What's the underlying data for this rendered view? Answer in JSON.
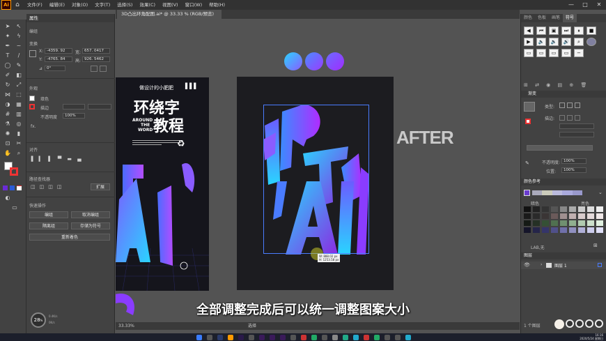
{
  "app": {
    "logo": "Ai",
    "menus": [
      "文件(F)",
      "编辑(E)",
      "对象(O)",
      "文字(T)",
      "选择(S)",
      "效果(C)",
      "视图(V)",
      "窗口(W)",
      "帮助(H)"
    ],
    "window_controls": [
      "—",
      "□",
      "✕"
    ]
  },
  "document": {
    "tab_title": "3D凸出环角配图.ai* @ 33.33 % (RGB/预览)",
    "close": "×"
  },
  "properties": {
    "tab": "属性",
    "group_label": "编组",
    "transform_label": "变换",
    "x_label": "X:",
    "x_value": "-4359. 92",
    "y_label": "Y:",
    "y_value": "-4765. 84",
    "w_label": "宽:",
    "w_value": "657. 0417",
    "h_label": "高:",
    "h_value": "926. 5462",
    "angle_value": "0°",
    "appearance_label": "外观",
    "fill_label": "填色",
    "stroke_label": "描边",
    "opacity_label": "不透明度",
    "opacity_value": "100%",
    "fx_label": "fx.",
    "align_label": "对齐",
    "pathfinder_label": "路径查找器",
    "expand_label": "扩展",
    "quick_actions_label": "快速操作",
    "btn_edit": "编组",
    "btn_ungroup": "取消编组",
    "btn_isolate": "隔离组",
    "btn_save_symbol": "存储为符号",
    "btn_recolor": "重新着色",
    "badge_number": "28",
    "badge_unit": "%",
    "speed_up": "0.4K/s",
    "speed_down": "0K/s"
  },
  "right_panel": {
    "tabs": [
      "颜色",
      "色板",
      "画笔",
      "符号"
    ],
    "active_tab": "符号",
    "gradient_title": "渐变",
    "gradient_type_label": "类型:",
    "stroke_label": "描边:",
    "opacity_label": "不透明度:",
    "opacity_value": "100%",
    "position_label": "位置:",
    "position_value": "100%",
    "color_guide_title": "颜色参考",
    "color_guide_tint": "暗色",
    "color_guide_shade": "亮色",
    "color_guide_footer": "LAB,无",
    "layers_title": "图层",
    "layer_name": "图层 1",
    "layers_count": "1 个图层"
  },
  "canvas": {
    "poster_small_title": "做设计的小肥肥",
    "poster_main1": "环绕字",
    "poster_main2": "教程",
    "poster_around": "AROUND",
    "poster_the": "THE",
    "poster_word": "WORD",
    "after_label": "AFTER",
    "dim_w": "W: 888.02 px",
    "dim_h": "H: 1253.58 px"
  },
  "status": {
    "zoom": "33.33%",
    "mode": "选择"
  },
  "subtitle": "全部调整完成后可以统一调整图案大小",
  "taskbar": {
    "time": "16:16",
    "date": "2020/5/24 星期日"
  },
  "colors": {
    "accent_gradient_start": "#2ad4ff",
    "accent_gradient_end": "#8a2be2",
    "poster_bg": "#1a1a1f",
    "artboard_bg": "#1e1e22"
  }
}
